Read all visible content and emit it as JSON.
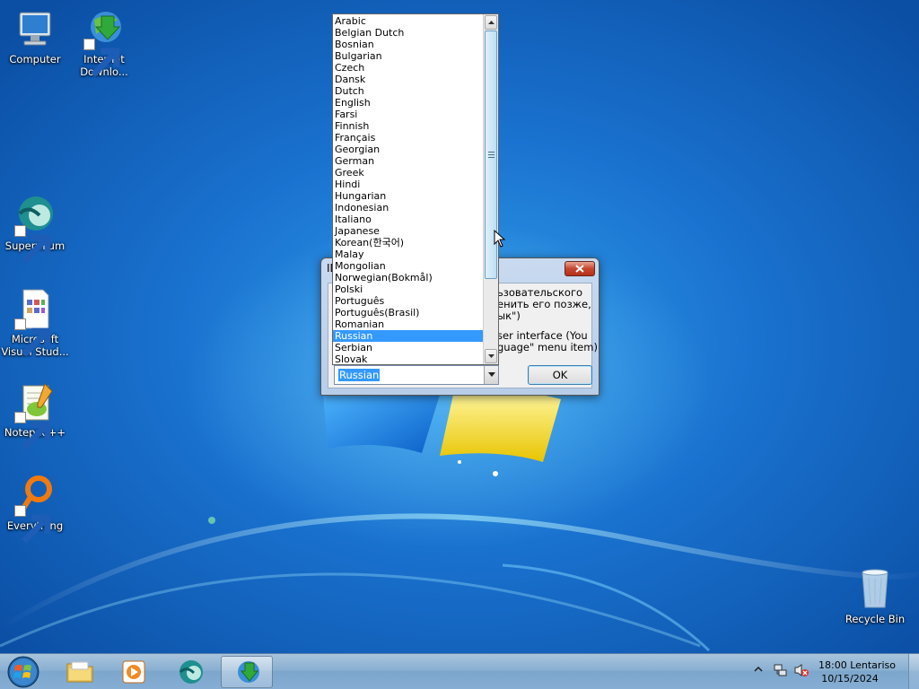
{
  "desktop": {
    "icons": [
      {
        "label": "Computer",
        "icon": "computer-icon"
      },
      {
        "label": "Internet Downlo...",
        "icon": "internet-download-manager-icon"
      },
      {
        "label": "Supermium",
        "icon": "supermium-icon"
      },
      {
        "label": "Microsoft Visual Stud...",
        "icon": "visual-studio-icon"
      },
      {
        "label": "Notepad++",
        "icon": "notepad-plus-plus-icon"
      },
      {
        "label": "Everything",
        "icon": "everything-search-icon"
      },
      {
        "label": "Recycle Bin",
        "icon": "recycle-bin-icon"
      }
    ]
  },
  "dialog": {
    "title": "ID",
    "message_lines": [
      "ьзовательского",
      "енить его позже,",
      "ык\")",
      "",
      "ser interface (You",
      "guage\" menu item)"
    ],
    "ok_label": "OK",
    "select_value": "Russian"
  },
  "language_list": {
    "items": [
      "Arabic",
      "Belgian Dutch",
      "Bosnian",
      "Bulgarian",
      "Czech",
      "Dansk",
      "Dutch",
      "English",
      "Farsi",
      "Finnish",
      "Français",
      "Georgian",
      "German",
      "Greek",
      "Hindi",
      "Hungarian",
      "Indonesian",
      "Italiano",
      "Japanese",
      "Korean(한국어)",
      "Malay",
      "Mongolian",
      "Norwegian(Bokmål)",
      "Polski",
      "Português",
      "Português(Brasil)",
      "Romanian",
      "Russian",
      "Serbian",
      "Slovak"
    ],
    "selected_index": 27
  },
  "taskbar": {
    "apps": [
      {
        "name": "file-explorer",
        "icon": "folder-icon"
      },
      {
        "name": "media-player",
        "icon": "media-player-icon"
      },
      {
        "name": "supermium",
        "icon": "supermium-icon"
      },
      {
        "name": "internet-download-manager",
        "icon": "internet-download-manager-icon"
      }
    ],
    "clock_time": "18:00 Lentariso",
    "clock_date": "10/15/2024"
  }
}
